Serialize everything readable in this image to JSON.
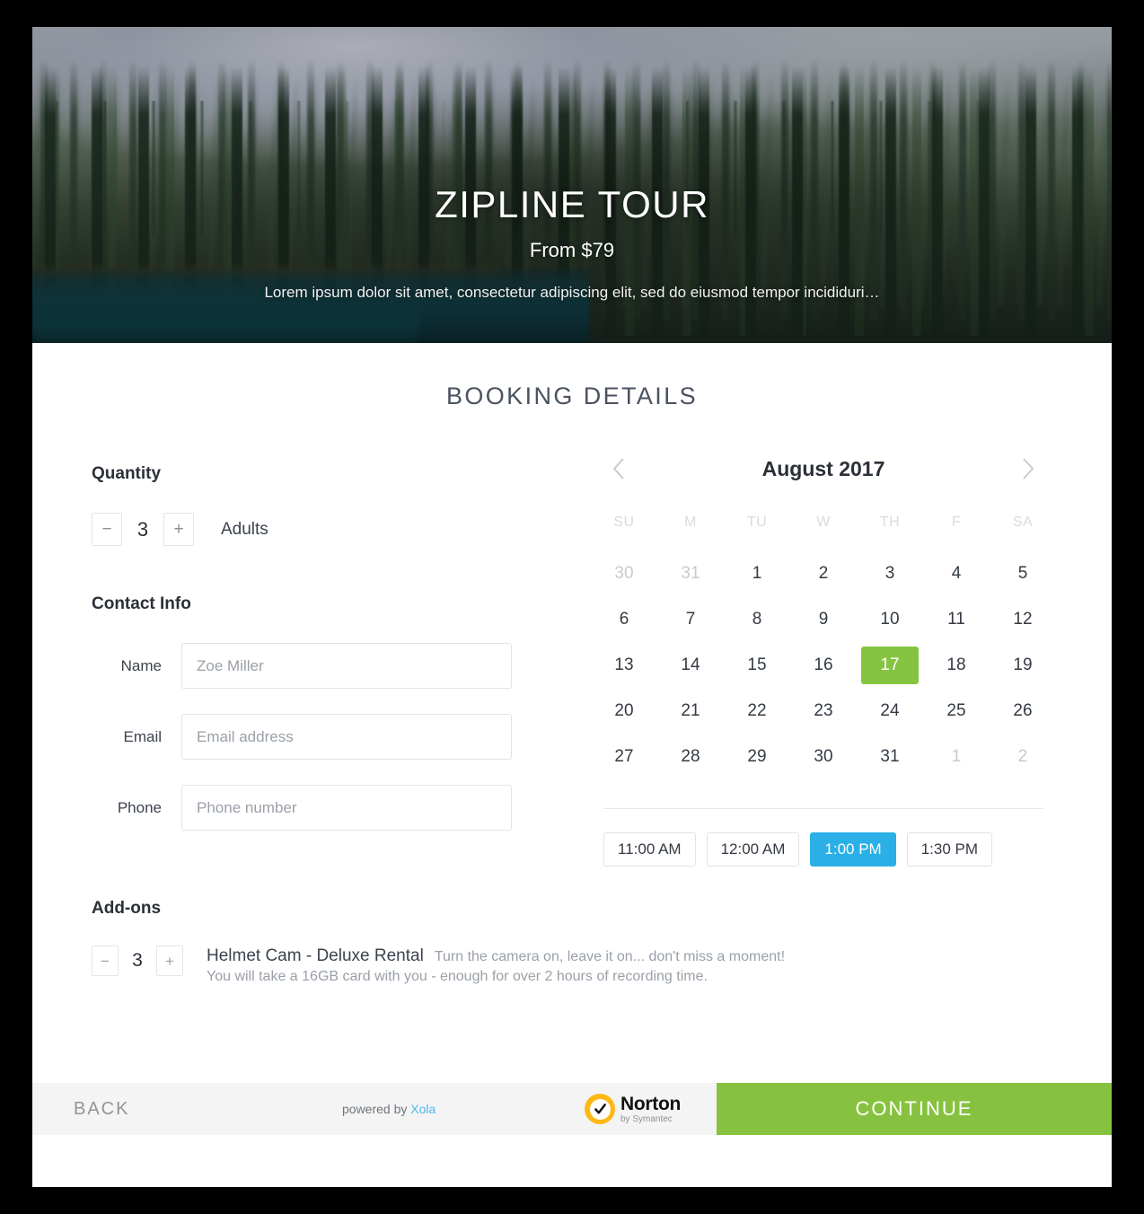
{
  "hero": {
    "title": "ZIPLINE TOUR",
    "price": "From $79",
    "description": "Lorem ipsum dolor sit amet, consectetur adipiscing elit, sed do eiusmod tempor incididuri…"
  },
  "section": {
    "title": "BOOKING DETAILS"
  },
  "quantity": {
    "heading": "Quantity",
    "decrement": "−",
    "increment": "+",
    "value": "3",
    "label": "Adults"
  },
  "contact": {
    "heading": "Contact Info",
    "fields": [
      {
        "label": "Name",
        "placeholder": "Zoe Miller",
        "value": ""
      },
      {
        "label": "Email",
        "placeholder": "Email address",
        "value": ""
      },
      {
        "label": "Phone",
        "placeholder": "Phone number",
        "value": ""
      }
    ]
  },
  "calendar": {
    "prev_icon": "chevron-left-icon",
    "next_icon": "chevron-right-icon",
    "month": "August 2017",
    "weekdays": [
      "SU",
      "M",
      "TU",
      "W",
      "TH",
      "F",
      "SA"
    ],
    "weeks": [
      [
        {
          "d": "30",
          "muted": true
        },
        {
          "d": "31",
          "muted": true
        },
        {
          "d": "1"
        },
        {
          "d": "2"
        },
        {
          "d": "3"
        },
        {
          "d": "4"
        },
        {
          "d": "5"
        }
      ],
      [
        {
          "d": "6"
        },
        {
          "d": "7"
        },
        {
          "d": "8"
        },
        {
          "d": "9"
        },
        {
          "d": "10"
        },
        {
          "d": "11"
        },
        {
          "d": "12"
        }
      ],
      [
        {
          "d": "13"
        },
        {
          "d": "14"
        },
        {
          "d": "15"
        },
        {
          "d": "16"
        },
        {
          "d": "17",
          "selected": true
        },
        {
          "d": "18"
        },
        {
          "d": "19"
        }
      ],
      [
        {
          "d": "20"
        },
        {
          "d": "21"
        },
        {
          "d": "22"
        },
        {
          "d": "23"
        },
        {
          "d": "24"
        },
        {
          "d": "25"
        },
        {
          "d": "26"
        }
      ],
      [
        {
          "d": "27"
        },
        {
          "d": "28"
        },
        {
          "d": "29"
        },
        {
          "d": "30"
        },
        {
          "d": "31"
        },
        {
          "d": "1",
          "muted": true
        },
        {
          "d": "2",
          "muted": true
        }
      ]
    ],
    "selected_date": "17",
    "time_slots": [
      {
        "label": "11:00 AM",
        "active": false
      },
      {
        "label": "12:00 AM",
        "active": false
      },
      {
        "label": "1:00 PM",
        "active": true
      },
      {
        "label": "1:30 PM",
        "active": false
      }
    ]
  },
  "addons": {
    "heading": "Add-ons",
    "items": [
      {
        "decrement": "−",
        "increment": "+",
        "value": "3",
        "name": "Helmet Cam - Deluxe Rental",
        "tagline": "Turn the camera on, leave it on... don't miss a moment!",
        "detail": "You will take a 16GB card with you - enough for over 2 hours of recording time."
      }
    ]
  },
  "footer": {
    "back_label": "BACK",
    "powered_prefix": "powered by ",
    "powered_brand": "Xola",
    "norton_name": "Norton",
    "norton_sub": "by Symantec",
    "continue_label": "CONTINUE"
  },
  "colors": {
    "green": "#85c440",
    "blue": "#2ab0e6",
    "footer_bg": "#f4f4f4",
    "norton_yellow": "#fdb913",
    "xola_blue": "#4db8ef"
  }
}
